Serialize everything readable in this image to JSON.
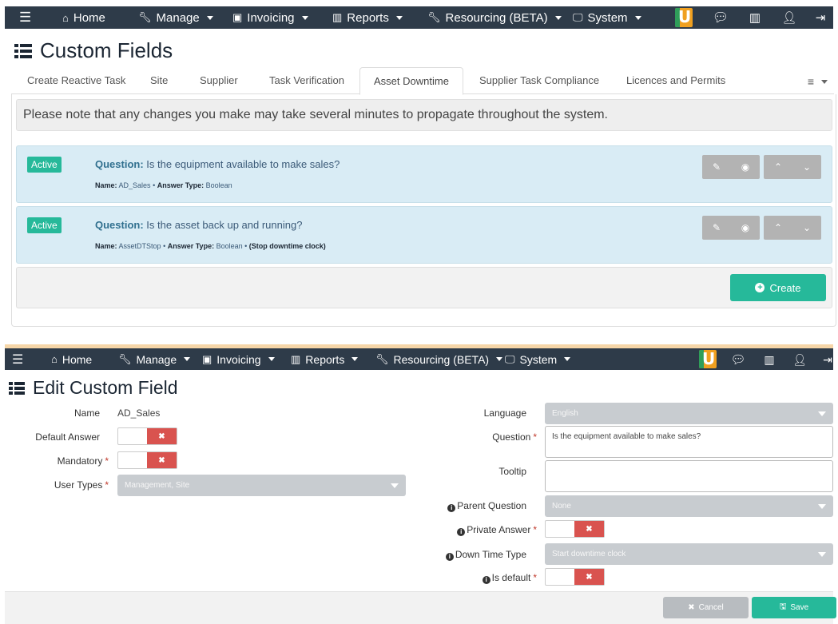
{
  "nav": {
    "home": "Home",
    "manage": "Manage",
    "invoicing": "Invoicing",
    "reports": "Reports",
    "resourcing": "Resourcing (BETA)",
    "system": "System"
  },
  "custom_fields": {
    "title": "Custom Fields",
    "tabs": [
      {
        "label": "Create Reactive Task"
      },
      {
        "label": "Site"
      },
      {
        "label": "Supplier"
      },
      {
        "label": "Task Verification"
      },
      {
        "label": "Asset Downtime",
        "active": true
      },
      {
        "label": "Supplier Task Compliance"
      },
      {
        "label": "Licences and Permits"
      }
    ],
    "notice": "Please note that any changes you make may take several minutes to propagate throughout the system.",
    "questions": [
      {
        "status": "Active",
        "question_label": "Question:",
        "question": "Is the equipment available to make sales?",
        "name_label": "Name:",
        "name": "AD_Sales",
        "type_label": "Answer Type:",
        "type": "Boolean",
        "extra": ""
      },
      {
        "status": "Active",
        "question_label": "Question:",
        "question": "Is the asset back up and running?",
        "name_label": "Name:",
        "name": "AssetDTStop",
        "type_label": "Answer Type:",
        "type": "Boolean",
        "extra": "(Stop downtime clock)"
      }
    ],
    "create_label": "Create"
  },
  "edit": {
    "title": "Edit Custom Field",
    "name_label": "Name",
    "name_value": "AD_Sales",
    "default_answer_label": "Default Answer",
    "mandatory_label": "Mandatory",
    "user_types_label": "User Types",
    "user_types_value": "Management, Site",
    "language_label": "Language",
    "language_value": "English",
    "question_label": "Question",
    "question_value": "Is the equipment available to make sales?",
    "tooltip_label": "Tooltip",
    "tooltip_value": "",
    "parent_question_label": "Parent Question",
    "parent_question_value": "None",
    "private_answer_label": "Private Answer",
    "down_time_type_label": "Down Time Type",
    "down_time_type_value": "Start downtime clock",
    "is_default_label": "Is default",
    "cancel_label": "Cancel",
    "save_label": "Save"
  },
  "colors": {
    "navbar": "#2e3b49",
    "accent_green": "#26b99a",
    "toggle_off_red": "#d9534f",
    "question_card_bg": "#d9ecf5"
  },
  "icons": [
    "hamburger-icon",
    "home-icon",
    "wrench-icon",
    "money-icon",
    "bar-chart-icon",
    "desktop-icon",
    "logo-icon",
    "comment-icon",
    "user-icon",
    "sign-out-icon",
    "list-icon",
    "pencil-icon",
    "target-icon",
    "chevron-up-icon",
    "chevron-down-icon",
    "plus-circle-icon",
    "info-icon",
    "times-icon",
    "save-icon"
  ]
}
